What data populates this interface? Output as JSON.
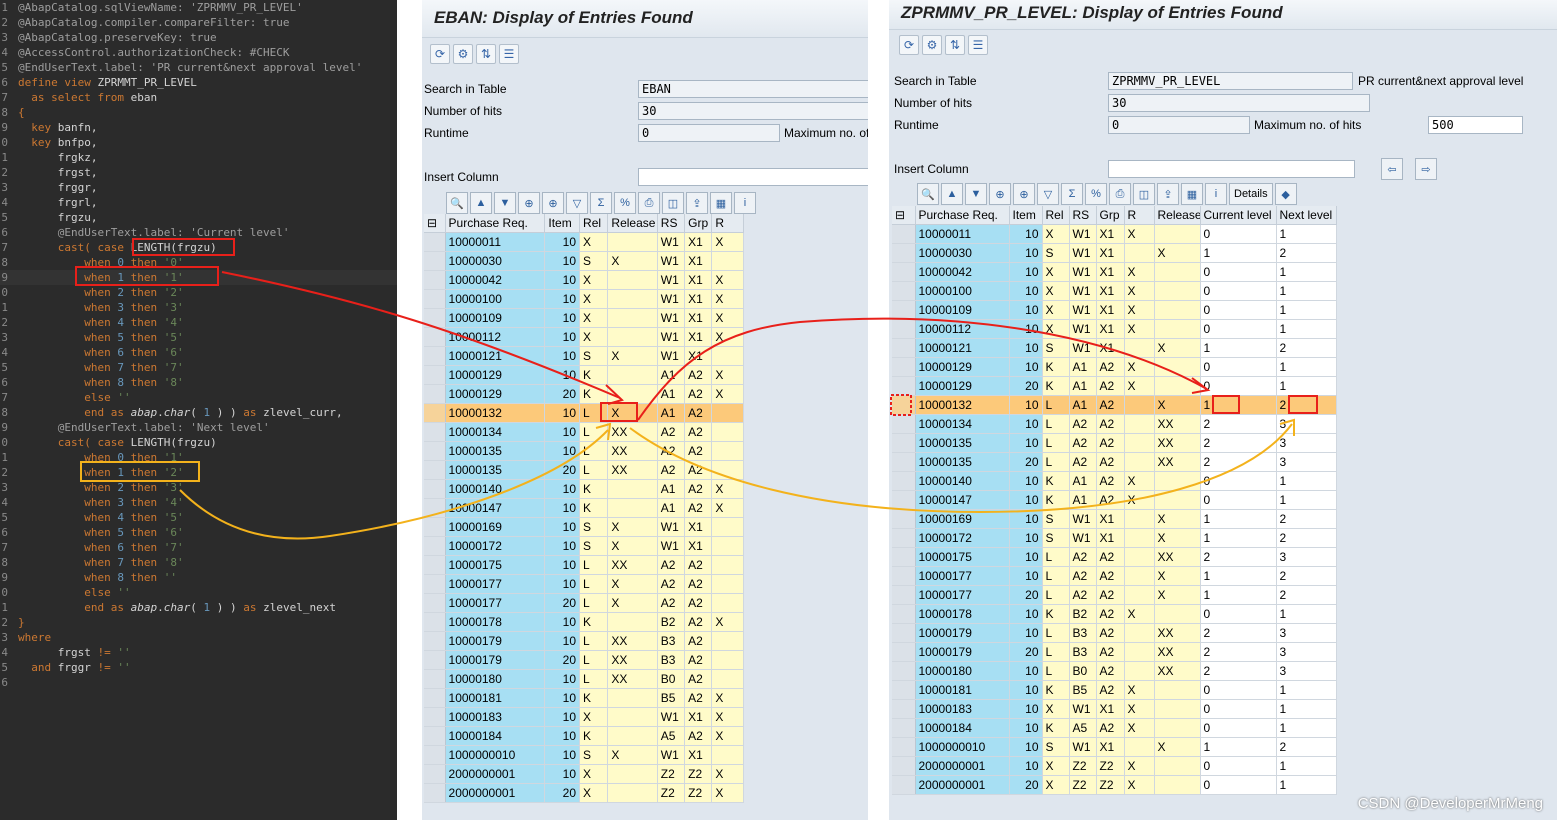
{
  "editor": {
    "lines": [
      {
        "n": "1",
        "html": "<span class='ann'>@AbapCatalog.sqlViewName: 'ZPRMMV_PR_LEVEL'</span>"
      },
      {
        "n": "2",
        "html": "<span class='ann'>@AbapCatalog.compiler.compareFilter: true</span>"
      },
      {
        "n": "3",
        "html": "<span class='ann'>@AbapCatalog.preserveKey: true</span>"
      },
      {
        "n": "4",
        "html": "<span class='ann'>@AccessControl.authorizationCheck: #CHECK</span>"
      },
      {
        "n": "5",
        "html": "<span class='ann'>@EndUserText.label: 'PR current&amp;next approval level'</span>"
      },
      {
        "n": "6",
        "html": "<span class='kw'>define view</span> ZPRMMT_PR_LEVEL"
      },
      {
        "n": "7",
        "html": "  <span class='kw'>as select from</span> eban"
      },
      {
        "n": "8",
        "html": "<span class='kw'>{</span>"
      },
      {
        "n": "9",
        "html": "  <span class='kw'>key</span> banfn,"
      },
      {
        "n": "0",
        "html": "  <span class='kw'>key</span> bnfpo,"
      },
      {
        "n": "1",
        "html": "      frgkz,"
      },
      {
        "n": "2",
        "html": "      frgst,"
      },
      {
        "n": "3",
        "html": "      frggr,"
      },
      {
        "n": "4",
        "html": "      frgrl,"
      },
      {
        "n": "5",
        "html": "      frgzu,"
      },
      {
        "n": "6",
        "html": "      <span class='ann'>@EndUserText.label: 'Current level'</span>"
      },
      {
        "n": "7",
        "html": "      <span class='kw'>cast( case</span> LENGTH(frgzu)"
      },
      {
        "n": "8",
        "html": "          <span class='kw'>when</span> <span class='num'>0</span> <span class='kw'>then</span> <span class='str'>'0'</span>"
      },
      {
        "n": "9",
        "html": "          <span class='kw'>when</span> <span class='num'>1</span> <span class='kw'>then</span> <span class='str'>'1'</span>",
        "hl": true
      },
      {
        "n": "0",
        "html": "          <span class='kw'>when</span> <span class='num'>2</span> <span class='kw'>then</span> <span class='str'>'2'</span>"
      },
      {
        "n": "1",
        "html": "          <span class='kw'>when</span> <span class='num'>3</span> <span class='kw'>then</span> <span class='str'>'3'</span>"
      },
      {
        "n": "2",
        "html": "          <span class='kw'>when</span> <span class='num'>4</span> <span class='kw'>then</span> <span class='str'>'4'</span>"
      },
      {
        "n": "3",
        "html": "          <span class='kw'>when</span> <span class='num'>5</span> <span class='kw'>then</span> <span class='str'>'5'</span>"
      },
      {
        "n": "4",
        "html": "          <span class='kw'>when</span> <span class='num'>6</span> <span class='kw'>then</span> <span class='str'>'6'</span>"
      },
      {
        "n": "5",
        "html": "          <span class='kw'>when</span> <span class='num'>7</span> <span class='kw'>then</span> <span class='str'>'7'</span>"
      },
      {
        "n": "6",
        "html": "          <span class='kw'>when</span> <span class='num'>8</span> <span class='kw'>then</span> <span class='str'>'8'</span>"
      },
      {
        "n": "7",
        "html": "          <span class='kw'>else</span> <span class='str'>''</span>"
      },
      {
        "n": "8",
        "html": "          <span class='kw'>end as</span> <span class='it'>abap</span>.<span class='it'>char</span>( <span class='num'>1</span> ) ) <span class='kw'>as</span> zlevel_curr,"
      },
      {
        "n": "9",
        "html": "      <span class='ann'>@EndUserText.label: 'Next level'</span>"
      },
      {
        "n": "0",
        "html": "      <span class='kw'>cast( case</span> LENGTH(frgzu)"
      },
      {
        "n": "1",
        "html": "          <span class='kw'>when</span> <span class='num'>0</span> <span class='kw'>then</span> <span class='str'>'1'</span>"
      },
      {
        "n": "2",
        "html": "          <span class='kw'>when</span> <span class='num'>1</span> <span class='kw'>then</span> <span class='str'>'2'</span>"
      },
      {
        "n": "3",
        "html": "          <span class='kw'>when</span> <span class='num'>2</span> <span class='kw'>then</span> <span class='str'>'3'</span>"
      },
      {
        "n": "4",
        "html": "          <span class='kw'>when</span> <span class='num'>3</span> <span class='kw'>then</span> <span class='str'>'4'</span>"
      },
      {
        "n": "5",
        "html": "          <span class='kw'>when</span> <span class='num'>4</span> <span class='kw'>then</span> <span class='str'>'5'</span>"
      },
      {
        "n": "6",
        "html": "          <span class='kw'>when</span> <span class='num'>5</span> <span class='kw'>then</span> <span class='str'>'6'</span>"
      },
      {
        "n": "7",
        "html": "          <span class='kw'>when</span> <span class='num'>6</span> <span class='kw'>then</span> <span class='str'>'7'</span>"
      },
      {
        "n": "8",
        "html": "          <span class='kw'>when</span> <span class='num'>7</span> <span class='kw'>then</span> <span class='str'>'8'</span>"
      },
      {
        "n": "9",
        "html": "          <span class='kw'>when</span> <span class='num'>8</span> <span class='kw'>then</span> <span class='str'>''</span>"
      },
      {
        "n": "0",
        "html": "          <span class='kw'>else</span> <span class='str'>''</span>"
      },
      {
        "n": "1",
        "html": "          <span class='kw'>end as</span> <span class='it'>abap</span>.<span class='it'>char</span>( <span class='num'>1</span> ) ) <span class='kw'>as</span> zlevel_next"
      },
      {
        "n": "2",
        "html": "<span class='kw'>}</span>"
      },
      {
        "n": "3",
        "html": "<span class='kw'>where</span>"
      },
      {
        "n": "4",
        "html": "      frgst <span class='kw'>!=</span> <span class='str'>''</span>"
      },
      {
        "n": "5",
        "html": "  <span class='kw'>and</span> frggr <span class='kw'>!=</span> <span class='str'>''</span>"
      },
      {
        "n": "6",
        "html": ""
      }
    ]
  },
  "win1": {
    "title": "EBAN: Display of Entries Found",
    "search_label": "Search in Table",
    "search_value": "EBAN",
    "hits_label": "Number of hits",
    "hits_value": "30",
    "runtime_label": "Runtime",
    "runtime_value": "0",
    "max_label": "Maximum no. of hits",
    "insert_label": "Insert Column",
    "columns": [
      "Purchase Req.",
      "Item",
      "Rel",
      "Release",
      "RS",
      "Grp",
      "R"
    ],
    "rows": [
      [
        "10000011",
        "10",
        "X",
        "",
        "W1",
        "X1",
        "X"
      ],
      [
        "10000030",
        "10",
        "S",
        "X",
        "W1",
        "X1",
        ""
      ],
      [
        "10000042",
        "10",
        "X",
        "",
        "W1",
        "X1",
        "X"
      ],
      [
        "10000100",
        "10",
        "X",
        "",
        "W1",
        "X1",
        "X"
      ],
      [
        "10000109",
        "10",
        "X",
        "",
        "W1",
        "X1",
        "X"
      ],
      [
        "10000112",
        "10",
        "X",
        "",
        "W1",
        "X1",
        "X"
      ],
      [
        "10000121",
        "10",
        "S",
        "X",
        "W1",
        "X1",
        ""
      ],
      [
        "10000129",
        "10",
        "K",
        "",
        "A1",
        "A2",
        "X"
      ],
      [
        "10000129",
        "20",
        "K",
        "",
        "A1",
        "A2",
        "X"
      ],
      [
        "10000132",
        "10",
        "L",
        "X",
        "A1",
        "A2",
        ""
      ],
      [
        "10000134",
        "10",
        "L",
        "XX",
        "A2",
        "A2",
        ""
      ],
      [
        "10000135",
        "10",
        "L",
        "XX",
        "A2",
        "A2",
        ""
      ],
      [
        "10000135",
        "20",
        "L",
        "XX",
        "A2",
        "A2",
        ""
      ],
      [
        "10000140",
        "10",
        "K",
        "",
        "A1",
        "A2",
        "X"
      ],
      [
        "10000147",
        "10",
        "K",
        "",
        "A1",
        "A2",
        "X"
      ],
      [
        "10000169",
        "10",
        "S",
        "X",
        "W1",
        "X1",
        ""
      ],
      [
        "10000172",
        "10",
        "S",
        "X",
        "W1",
        "X1",
        ""
      ],
      [
        "10000175",
        "10",
        "L",
        "XX",
        "A2",
        "A2",
        ""
      ],
      [
        "10000177",
        "10",
        "L",
        "X",
        "A2",
        "A2",
        ""
      ],
      [
        "10000177",
        "20",
        "L",
        "X",
        "A2",
        "A2",
        ""
      ],
      [
        "10000178",
        "10",
        "K",
        "",
        "B2",
        "A2",
        "X"
      ],
      [
        "10000179",
        "10",
        "L",
        "XX",
        "B3",
        "A2",
        ""
      ],
      [
        "10000179",
        "20",
        "L",
        "XX",
        "B3",
        "A2",
        ""
      ],
      [
        "10000180",
        "10",
        "L",
        "XX",
        "B0",
        "A2",
        ""
      ],
      [
        "10000181",
        "10",
        "K",
        "",
        "B5",
        "A2",
        "X"
      ],
      [
        "10000183",
        "10",
        "X",
        "",
        "W1",
        "X1",
        "X"
      ],
      [
        "10000184",
        "10",
        "K",
        "",
        "A5",
        "A2",
        "X"
      ],
      [
        "1000000010",
        "10",
        "S",
        "X",
        "W1",
        "X1",
        ""
      ],
      [
        "2000000001",
        "10",
        "X",
        "",
        "Z2",
        "Z2",
        "X"
      ],
      [
        "2000000001",
        "20",
        "X",
        "",
        "Z2",
        "Z2",
        "X"
      ]
    ]
  },
  "win2": {
    "title": "ZPRMMV_PR_LEVEL: Display of Entries Found",
    "search_label": "Search in Table",
    "search_value": "ZPRMMV_PR_LEVEL",
    "search_desc": "PR current&next approval level",
    "hits_label": "Number of hits",
    "hits_value": "30",
    "runtime_label": "Runtime",
    "runtime_value": "0",
    "max_label": "Maximum no. of hits",
    "max_value": "500",
    "insert_label": "Insert Column",
    "details_label": "Details",
    "columns": [
      "Purchase Req.",
      "Item",
      "Rel",
      "RS",
      "Grp",
      "R",
      "Release",
      "Current level",
      "Next level"
    ],
    "rows": [
      [
        "10000011",
        "10",
        "X",
        "W1",
        "X1",
        "X",
        "",
        "0",
        "1"
      ],
      [
        "10000030",
        "10",
        "S",
        "W1",
        "X1",
        "",
        "X",
        "1",
        "2"
      ],
      [
        "10000042",
        "10",
        "X",
        "W1",
        "X1",
        "X",
        "",
        "0",
        "1"
      ],
      [
        "10000100",
        "10",
        "X",
        "W1",
        "X1",
        "X",
        "",
        "0",
        "1"
      ],
      [
        "10000109",
        "10",
        "X",
        "W1",
        "X1",
        "X",
        "",
        "0",
        "1"
      ],
      [
        "10000112",
        "10",
        "X",
        "W1",
        "X1",
        "X",
        "",
        "0",
        "1"
      ],
      [
        "10000121",
        "10",
        "S",
        "W1",
        "X1",
        "",
        "X",
        "1",
        "2"
      ],
      [
        "10000129",
        "10",
        "K",
        "A1",
        "A2",
        "X",
        "",
        "0",
        "1"
      ],
      [
        "10000129",
        "20",
        "K",
        "A1",
        "A2",
        "X",
        "",
        "0",
        "1"
      ],
      [
        "10000132",
        "10",
        "L",
        "A1",
        "A2",
        "",
        "X",
        "1",
        "2"
      ],
      [
        "10000134",
        "10",
        "L",
        "A2",
        "A2",
        "",
        "XX",
        "2",
        "3"
      ],
      [
        "10000135",
        "10",
        "L",
        "A2",
        "A2",
        "",
        "XX",
        "2",
        "3"
      ],
      [
        "10000135",
        "20",
        "L",
        "A2",
        "A2",
        "",
        "XX",
        "2",
        "3"
      ],
      [
        "10000140",
        "10",
        "K",
        "A1",
        "A2",
        "X",
        "",
        "0",
        "1"
      ],
      [
        "10000147",
        "10",
        "K",
        "A1",
        "A2",
        "X",
        "",
        "0",
        "1"
      ],
      [
        "10000169",
        "10",
        "S",
        "W1",
        "X1",
        "",
        "X",
        "1",
        "2"
      ],
      [
        "10000172",
        "10",
        "S",
        "W1",
        "X1",
        "",
        "X",
        "1",
        "2"
      ],
      [
        "10000175",
        "10",
        "L",
        "A2",
        "A2",
        "",
        "XX",
        "2",
        "3"
      ],
      [
        "10000177",
        "10",
        "L",
        "A2",
        "A2",
        "",
        "X",
        "1",
        "2"
      ],
      [
        "10000177",
        "20",
        "L",
        "A2",
        "A2",
        "",
        "X",
        "1",
        "2"
      ],
      [
        "10000178",
        "10",
        "K",
        "B2",
        "A2",
        "X",
        "",
        "0",
        "1"
      ],
      [
        "10000179",
        "10",
        "L",
        "B3",
        "A2",
        "",
        "XX",
        "2",
        "3"
      ],
      [
        "10000179",
        "20",
        "L",
        "B3",
        "A2",
        "",
        "XX",
        "2",
        "3"
      ],
      [
        "10000180",
        "10",
        "L",
        "B0",
        "A2",
        "",
        "XX",
        "2",
        "3"
      ],
      [
        "10000181",
        "10",
        "K",
        "B5",
        "A2",
        "X",
        "",
        "0",
        "1"
      ],
      [
        "10000183",
        "10",
        "X",
        "W1",
        "X1",
        "X",
        "",
        "0",
        "1"
      ],
      [
        "10000184",
        "10",
        "K",
        "A5",
        "A2",
        "X",
        "",
        "0",
        "1"
      ],
      [
        "1000000010",
        "10",
        "S",
        "W1",
        "X1",
        "",
        "X",
        "1",
        "2"
      ],
      [
        "2000000001",
        "10",
        "X",
        "Z2",
        "Z2",
        "X",
        "",
        "0",
        "1"
      ],
      [
        "2000000001",
        "20",
        "X",
        "Z2",
        "Z2",
        "X",
        "",
        "0",
        "1"
      ]
    ]
  },
  "watermark": "CSDN @DeveloperMrMeng",
  "colors": {
    "annotation_red": "#e8201a",
    "annotation_orange": "#f3b21c",
    "selected_row": "#fcc97a",
    "key_col": "#a7dff3",
    "value_col": "#fffbc9"
  }
}
